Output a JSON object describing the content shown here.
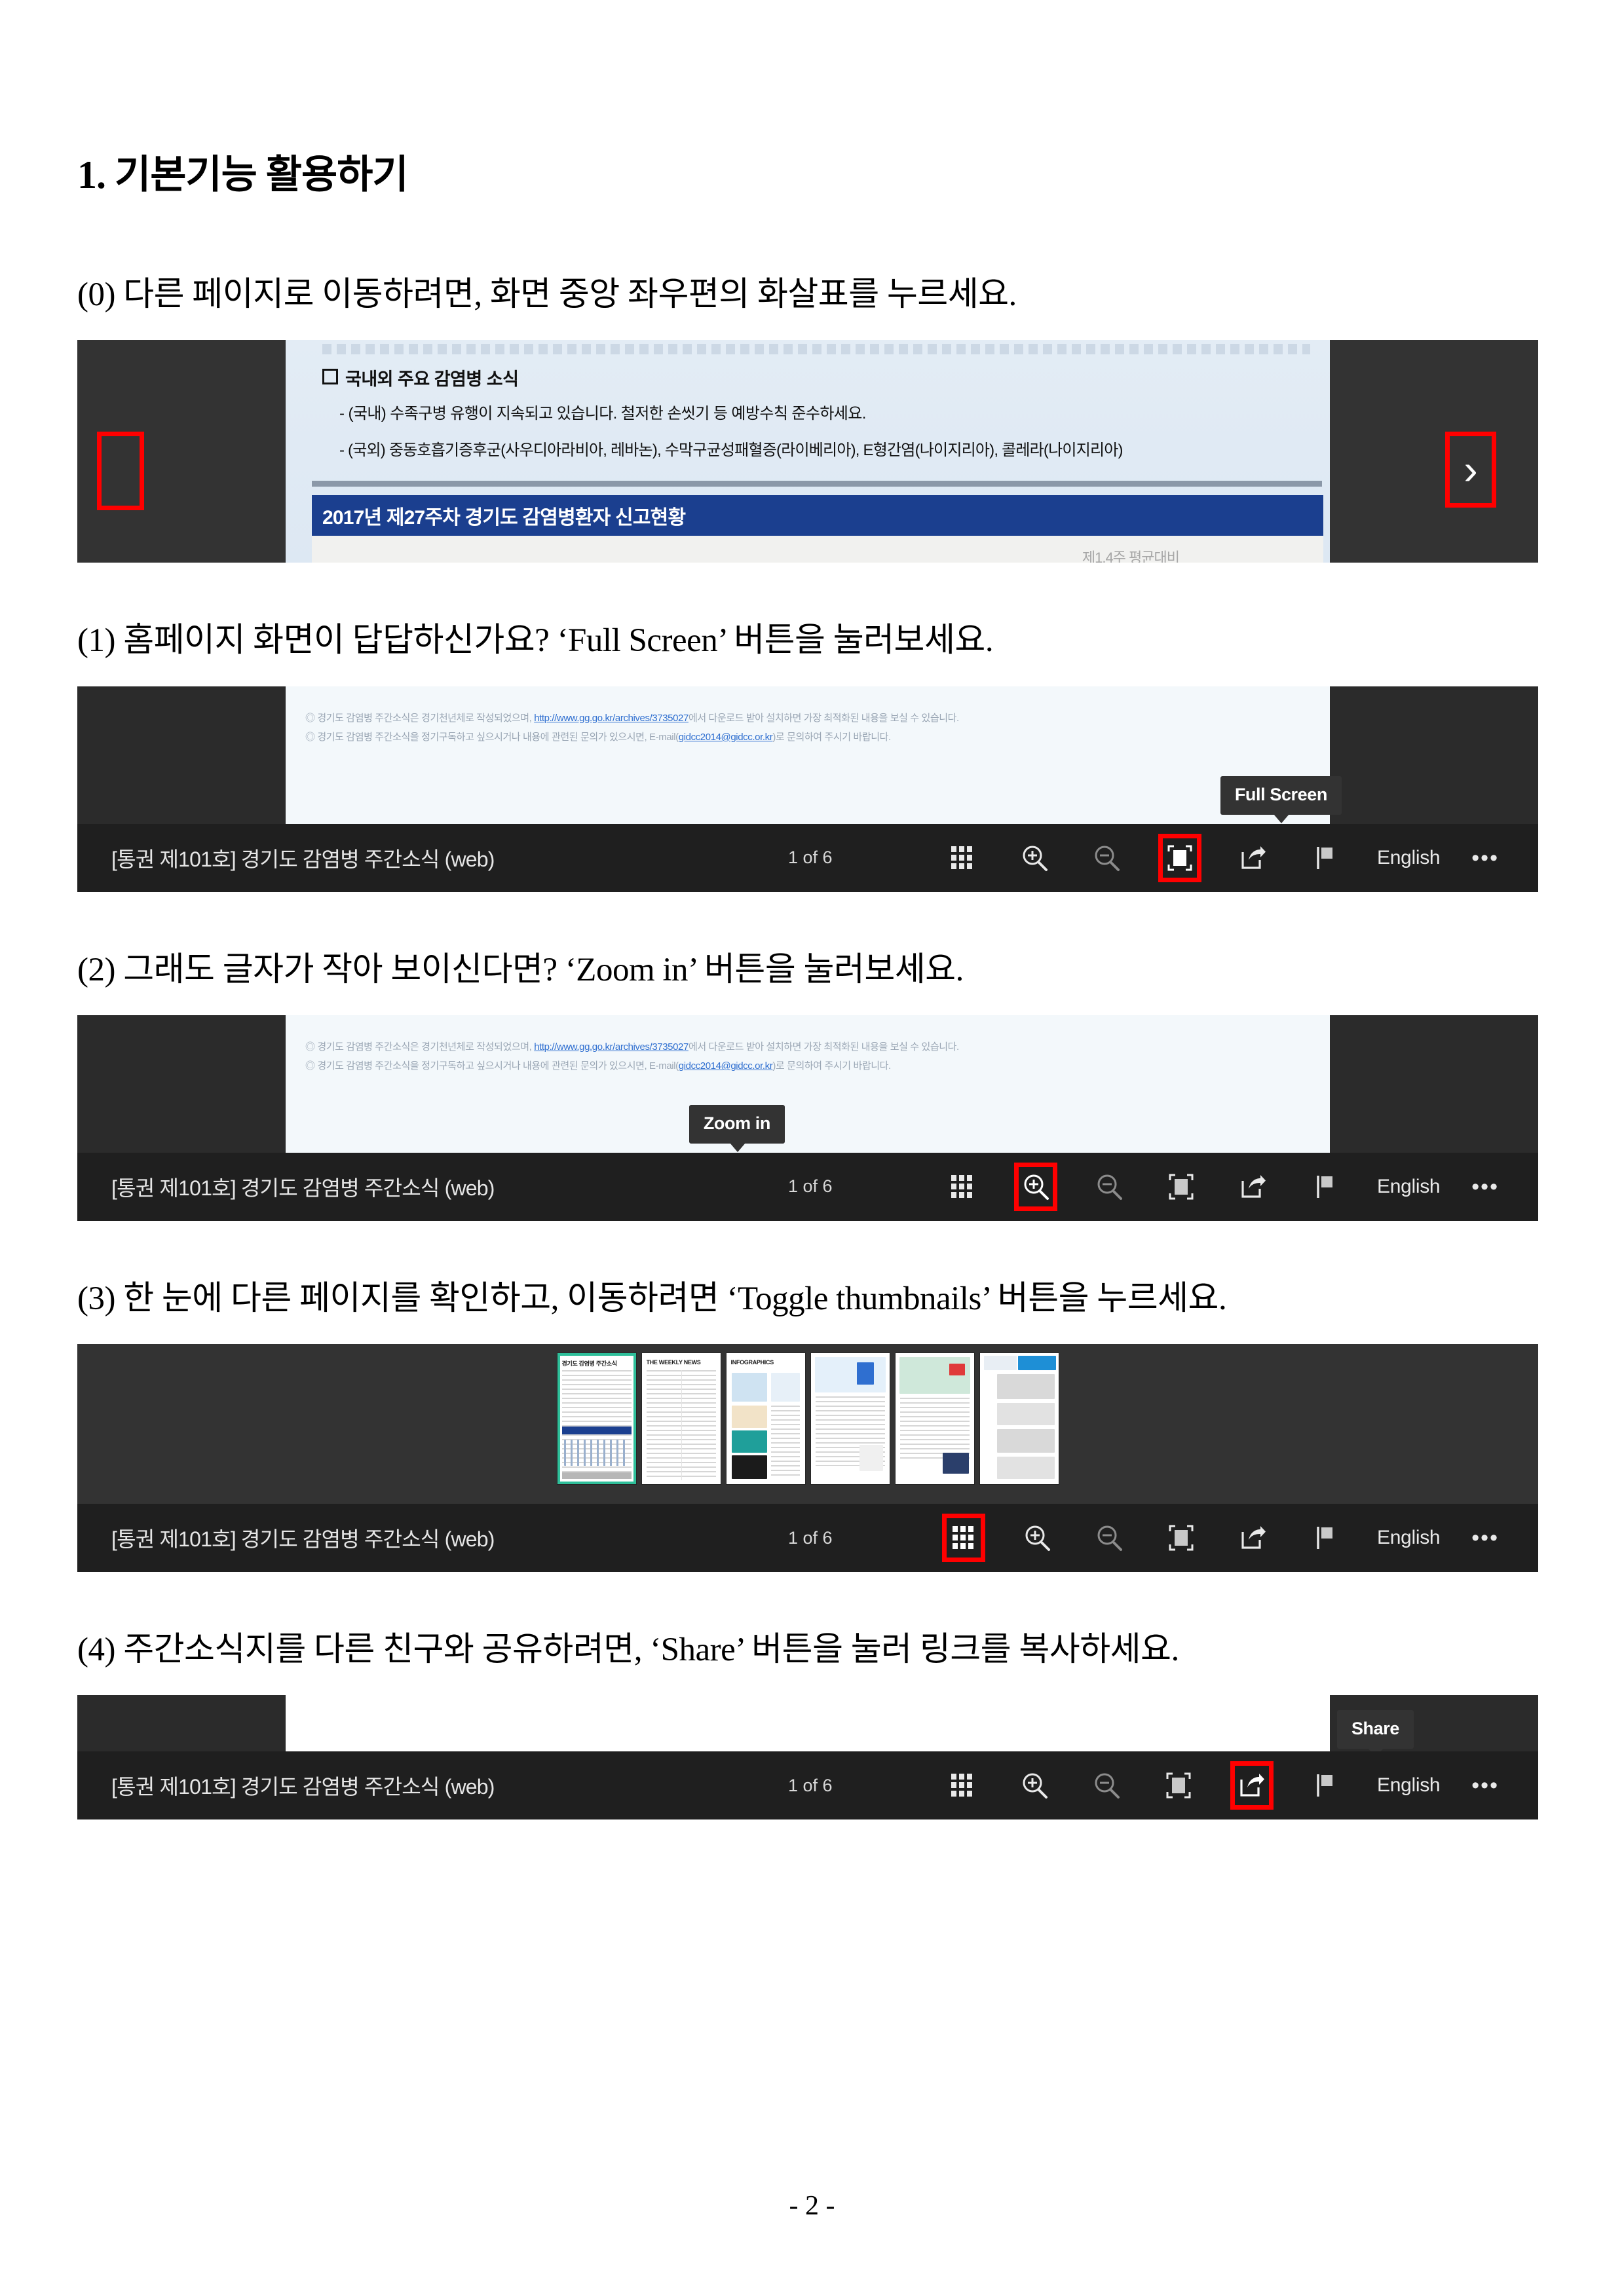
{
  "document": {
    "heading": "1. 기본기능 활용하기",
    "footer_page_number": "- 2 -"
  },
  "steps": [
    {
      "id": "0",
      "text": "(0) 다른 페이지로 이동하려면, 화면 중앙 좌우편의 화살표를 누르세요."
    },
    {
      "id": "1",
      "text": "(1) 홈페이지 화면이 답답하신가요? ‘Full Screen’ 버튼을 눌러보세요."
    },
    {
      "id": "2",
      "text": "(2) 그래도 글자가 작아 보이신다면? ‘Zoom in’ 버튼을 눌러보세요."
    },
    {
      "id": "3",
      "text": "(3) 한 눈에 다른 페이지를 확인하고, 이동하려면 ‘Toggle thumbnails’ 버튼을 누르세요."
    },
    {
      "id": "4",
      "text": "(4) 주간소식지를 다른 친구와 공유하려면, ‘Share’ 버튼을 눌러 링크를 복사하세요."
    }
  ],
  "newsletter_page": {
    "section_heading": "국내외 주요 감염병 소식",
    "line_domestic": "- (국내) 수족구병 유행이 지속되고 있습니다. 철저한 손씻기 등 예방수칙 준수하세요.",
    "line_overseas": "- (국외) 중동호흡기증후군(사우디아라비아, 레바논), 수막구균성패혈증(라이베리아), E형간염(나이지리아), 콜레라(나이지리아)",
    "banner_title": "2017년 제27주차 경기도 감염병환자 신고현황",
    "ghost_text": "제1.4주 평균대비"
  },
  "fineprint": {
    "line1_a": "◎ 경기도 감염병 주간소식은 경기천년체로 작성되었으며, ",
    "line1_link": "http://www.gg.go.kr/archives/3735027",
    "line1_b": "에서 다운로드 받아 설치하면 가장 최적화된 내용을 보실 수 있습니다.",
    "line2_a": "◎ 경기도 감염병 주간소식을 정기구독하고 싶으시거나 내용에 관련된 문의가 있으시면, E-mail(",
    "line2_link": "gidcc2014@gidcc.or.kr",
    "line2_b": ")로 문의하여 주시기 바랍니다."
  },
  "viewer": {
    "doc_title": "[통권 제101호] 경기도 감염병 주간소식 (web)",
    "page_indicator": "1 of 6",
    "language": "English",
    "more_label": "•••",
    "tools": [
      {
        "name": "toggle-thumbnails",
        "tooltip": "Toggle thumbnails"
      },
      {
        "name": "zoom-in",
        "tooltip": "Zoom in"
      },
      {
        "name": "zoom-out",
        "tooltip": "Zoom out"
      },
      {
        "name": "full-screen",
        "tooltip": "Full Screen"
      },
      {
        "name": "share",
        "tooltip": "Share"
      },
      {
        "name": "flag",
        "tooltip": "Flag"
      },
      {
        "name": "language",
        "tooltip": "English"
      },
      {
        "name": "more",
        "tooltip": "More"
      }
    ]
  },
  "tooltips": {
    "full_screen": "Full Screen",
    "zoom_in": "Zoom in",
    "share": "Share"
  },
  "thumbnails": [
    {
      "index": "1",
      "title": "경기도 감염병 주간소식",
      "selected": "true"
    },
    {
      "index": "2",
      "title": "THE WEEKLY NEWS",
      "selected": "false"
    },
    {
      "index": "3",
      "title": "INFOGRAPHICS",
      "selected": "false"
    },
    {
      "index": "4",
      "title": "",
      "selected": "false"
    },
    {
      "index": "5",
      "title": "",
      "selected": "false"
    },
    {
      "index": "6",
      "title": "",
      "selected": "false"
    }
  ],
  "colors": {
    "highlight_red": "#ff0000",
    "toolbar_bg": "#1f1f1f",
    "viewer_bg": "#2b2b2b",
    "banner_blue": "#1b3f8f",
    "thumb_selected": "#2fbf9a"
  }
}
